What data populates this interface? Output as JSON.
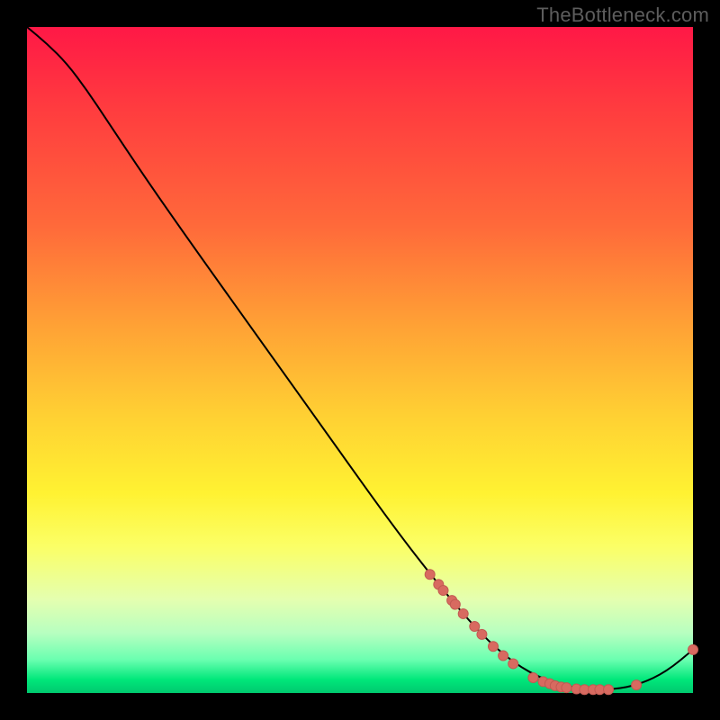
{
  "watermark": "TheBottleneck.com",
  "colors": {
    "curve_stroke": "#000000",
    "dot_fill": "#d86a60",
    "dot_stroke": "#c25a52",
    "gradient_top": "#ff1846",
    "gradient_bottom": "#00c96f"
  },
  "chart_data": {
    "type": "line",
    "title": "",
    "xlabel": "",
    "ylabel": "",
    "xlim": [
      0,
      100
    ],
    "ylim": [
      0,
      100
    ],
    "curve": [
      {
        "x": 0,
        "y": 100
      },
      {
        "x": 3,
        "y": 97.5
      },
      {
        "x": 6,
        "y": 94.5
      },
      {
        "x": 9,
        "y": 90.5
      },
      {
        "x": 12,
        "y": 86
      },
      {
        "x": 18,
        "y": 77
      },
      {
        "x": 25,
        "y": 67
      },
      {
        "x": 35,
        "y": 53
      },
      {
        "x": 45,
        "y": 39
      },
      {
        "x": 55,
        "y": 25
      },
      {
        "x": 62,
        "y": 16
      },
      {
        "x": 68,
        "y": 9
      },
      {
        "x": 73,
        "y": 4.5
      },
      {
        "x": 78,
        "y": 1.8
      },
      {
        "x": 83,
        "y": 0.6
      },
      {
        "x": 88,
        "y": 0.5
      },
      {
        "x": 92,
        "y": 1.3
      },
      {
        "x": 96,
        "y": 3.2
      },
      {
        "x": 100,
        "y": 6.5
      }
    ],
    "dots": [
      {
        "x": 60.5,
        "y": 17.8
      },
      {
        "x": 61.8,
        "y": 16.3
      },
      {
        "x": 62.5,
        "y": 15.4
      },
      {
        "x": 63.8,
        "y": 13.9
      },
      {
        "x": 64.3,
        "y": 13.3
      },
      {
        "x": 65.5,
        "y": 11.9
      },
      {
        "x": 67.2,
        "y": 10.0
      },
      {
        "x": 68.3,
        "y": 8.8
      },
      {
        "x": 70.0,
        "y": 7.0
      },
      {
        "x": 71.5,
        "y": 5.6
      },
      {
        "x": 73.0,
        "y": 4.4
      },
      {
        "x": 76.0,
        "y": 2.3
      },
      {
        "x": 77.5,
        "y": 1.7
      },
      {
        "x": 78.5,
        "y": 1.4
      },
      {
        "x": 79.3,
        "y": 1.1
      },
      {
        "x": 80.2,
        "y": 0.9
      },
      {
        "x": 81.0,
        "y": 0.8
      },
      {
        "x": 82.5,
        "y": 0.6
      },
      {
        "x": 83.7,
        "y": 0.5
      },
      {
        "x": 85.0,
        "y": 0.5
      },
      {
        "x": 86.0,
        "y": 0.5
      },
      {
        "x": 87.3,
        "y": 0.5
      },
      {
        "x": 91.5,
        "y": 1.2
      },
      {
        "x": 100.0,
        "y": 6.5
      }
    ]
  }
}
